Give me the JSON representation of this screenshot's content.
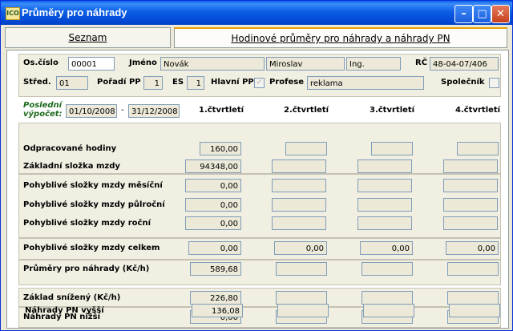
{
  "window": {
    "title": "Průměry pro náhrady",
    "icon": "app-icon",
    "buttons": [
      "minimize-icon",
      "maximize-icon",
      "close-icon"
    ]
  },
  "tabs": {
    "tab1": "Seznam",
    "tab2": "Hodinové průměry pro náhrady a náhrady PN"
  },
  "person": {
    "os_cislo_label": "Os.číslo",
    "os_cislo": "00001",
    "jmeno_label": "Jméno",
    "prijmeni": "Novák",
    "jmeno": "Miroslav",
    "titul": "Ing.",
    "rc_label": "RČ",
    "rc": "48-04-07/406",
    "stred_label": "Střed.",
    "stred": "01",
    "poradi_label": "Pořadí PP",
    "poradi": "1",
    "es_label": "ES",
    "es": "1",
    "hlavni_label": "Hlavní PP",
    "hlavni_checked": true,
    "profese_label": "Profese",
    "profese": "reklama",
    "spolecnik_label": "Společník",
    "spolecnik_checked": false
  },
  "period": {
    "label_line1": "Poslední",
    "label_line2": "výpočet:",
    "from": "01/10/2008",
    "dash": "-",
    "to": "31/12/2008"
  },
  "quarters": [
    "1.čtvrtletí",
    "2.čtvrtletí",
    "3.čtvrtletí",
    "4.čtvrtletí"
  ],
  "rows": {
    "odpracovane": {
      "label": "Odpracované hodiny",
      "q1": "160,00",
      "q2": "",
      "q3": "",
      "q4": ""
    },
    "zakladni": {
      "label": "Základní složka mzdy",
      "q1": "94348,00",
      "q2": "",
      "q3": "",
      "q4": ""
    },
    "mesicni": {
      "label": "Pohyblivé složky mzdy měsíční",
      "q1": "0,00",
      "q2": "",
      "q3": "",
      "q4": ""
    },
    "pulrocni": {
      "label": "Pohyblivé složky mzdy  půlroční",
      "q1": "0,00",
      "q2": "",
      "q3": "",
      "q4": ""
    },
    "rocni": {
      "label": "Pohyblivé složky mzdy  roční",
      "q1": "0,00",
      "q2": "",
      "q3": "",
      "q4": ""
    },
    "celkem": {
      "label": "Pohyblivé složky mzdy celkem",
      "q1": "0,00",
      "q2": "0,00",
      "q3": "0,00",
      "q4": "0,00"
    },
    "prumery": {
      "label": "Průměry pro  náhrady (Kč/h)",
      "q1": "589,68",
      "q2": "",
      "q3": "",
      "q4": ""
    },
    "zaklad_snizeny": {
      "label": "Základ snížený (Kč/h)",
      "q1": "226,80",
      "q2": "",
      "q3": "",
      "q4": ""
    },
    "nahrady_nizsi": {
      "label": "Náhrady PN nižší",
      "q1": "0,00",
      "q2": "",
      "q3": "",
      "q4": ""
    },
    "nahrady_vyssi": {
      "label": "Náhrady PN vyšší",
      "q1": "136,08",
      "q2": "",
      "q3": "",
      "q4": ""
    }
  }
}
